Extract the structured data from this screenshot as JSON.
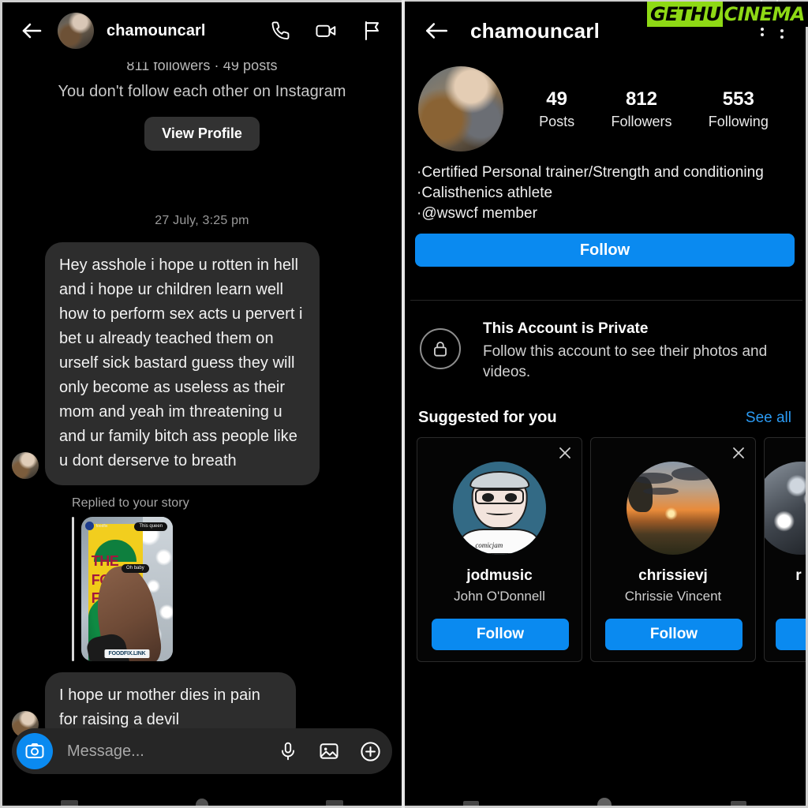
{
  "watermark": {
    "part1": "GETHU",
    "part2": "CINEMA",
    "green": "#8ed915"
  },
  "accent": {
    "blue": "#0a8af0",
    "link_blue": "#2b9bf4",
    "bubble": "#2d2d2d"
  },
  "left_panel": {
    "name": "instagram-direct-message-thread",
    "header": {
      "username": "chamouncarl",
      "back_icon": "back-arrow-icon",
      "avatar": "avatar",
      "actions": [
        "phone-call-icon",
        "video-call-icon",
        "flag-report-icon"
      ]
    },
    "subheader": {
      "counts": "811 followers · 49 posts",
      "note": "You don't follow each other on Instagram",
      "view_profile_label": "View Profile"
    },
    "thread": {
      "timestamp": "27 July, 3:25 pm",
      "messages": [
        {
          "id": "message-long",
          "text": "Hey asshole i hope u rotten in hell and i hope ur children learn well how to perform sex acts u pervert i bet u already teached them on urself sick bastard guess they will only become as useless as their mom and yeah im threatening u and ur family bitch ass people like u dont derserve to breath"
        },
        {
          "id": "message-short",
          "text": "I hope ur mother dies in pain for raising a devil"
        }
      ],
      "story_reply": {
        "label": "Replied to your story",
        "thumb_words": [
          "THE",
          "FOOD",
          "FI"
        ],
        "thumb_chip_left": "foodfix",
        "thumb_chip_queen": "This queen",
        "thumb_chip_ohbaby": "Oh baby",
        "thumb_badge": "FOODFIX.LINK"
      }
    },
    "composer": {
      "camera_icon": "camera-icon",
      "placeholder": "Message...",
      "value": "",
      "actions": [
        "microphone-icon",
        "gallery-image-icon",
        "plus-circle-icon"
      ]
    }
  },
  "right_panel": {
    "name": "instagram-profile-page",
    "header": {
      "username": "chamouncarl",
      "back_icon": "back-arrow-icon",
      "menu_icon": "more-options-icon"
    },
    "stats": [
      {
        "num": "49",
        "label": "Posts"
      },
      {
        "num": "812",
        "label": "Followers"
      },
      {
        "num": "553",
        "label": "Following"
      }
    ],
    "bio": [
      "·Certified Personal trainer/Strength and conditioning",
      "·Calisthenics athlete",
      "·@wswcf member"
    ],
    "follow_label": "Follow",
    "private": {
      "lock_icon": "lock-icon",
      "title": "This Account is Private",
      "subtitle": "Follow this account to see their photos and videos."
    },
    "suggested": {
      "title": "Suggested for you",
      "see_all": "See all",
      "cards": [
        {
          "username": "jodmusic",
          "fullname": "John O'Donnell",
          "follow": "Follow",
          "close_icon": "close-icon",
          "avatar": "cartoon-face-avatar",
          "shirt_text": "comicjam"
        },
        {
          "username": "chrissievj",
          "fullname": "Chrissie Vincent",
          "follow": "Follow",
          "close_icon": "close-icon",
          "avatar": "sunset-photo-avatar"
        },
        {
          "username": "r",
          "fullname": "",
          "follow": "Follow",
          "close_icon": "close-icon",
          "avatar": "disco-ball-avatar"
        }
      ]
    }
  }
}
